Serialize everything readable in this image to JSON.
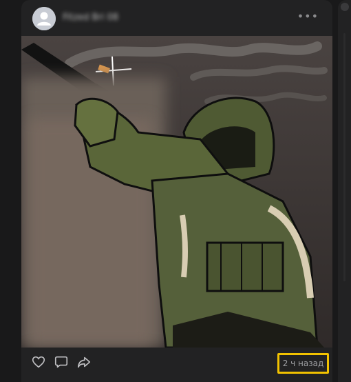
{
  "post": {
    "author_name": "Fitzed Bri 08",
    "more_label": "•••",
    "timestamp": "2 ч назад"
  },
  "icons": {
    "like": "heart-icon",
    "comment": "comment-icon",
    "share": "share-icon",
    "avatar": "user-placeholder-icon"
  },
  "colors": {
    "background": "#19191a",
    "card": "#222223",
    "highlight_border": "#f2c200",
    "timestamp_text": "#9fa0a3",
    "icon": "#c0c0c3"
  }
}
